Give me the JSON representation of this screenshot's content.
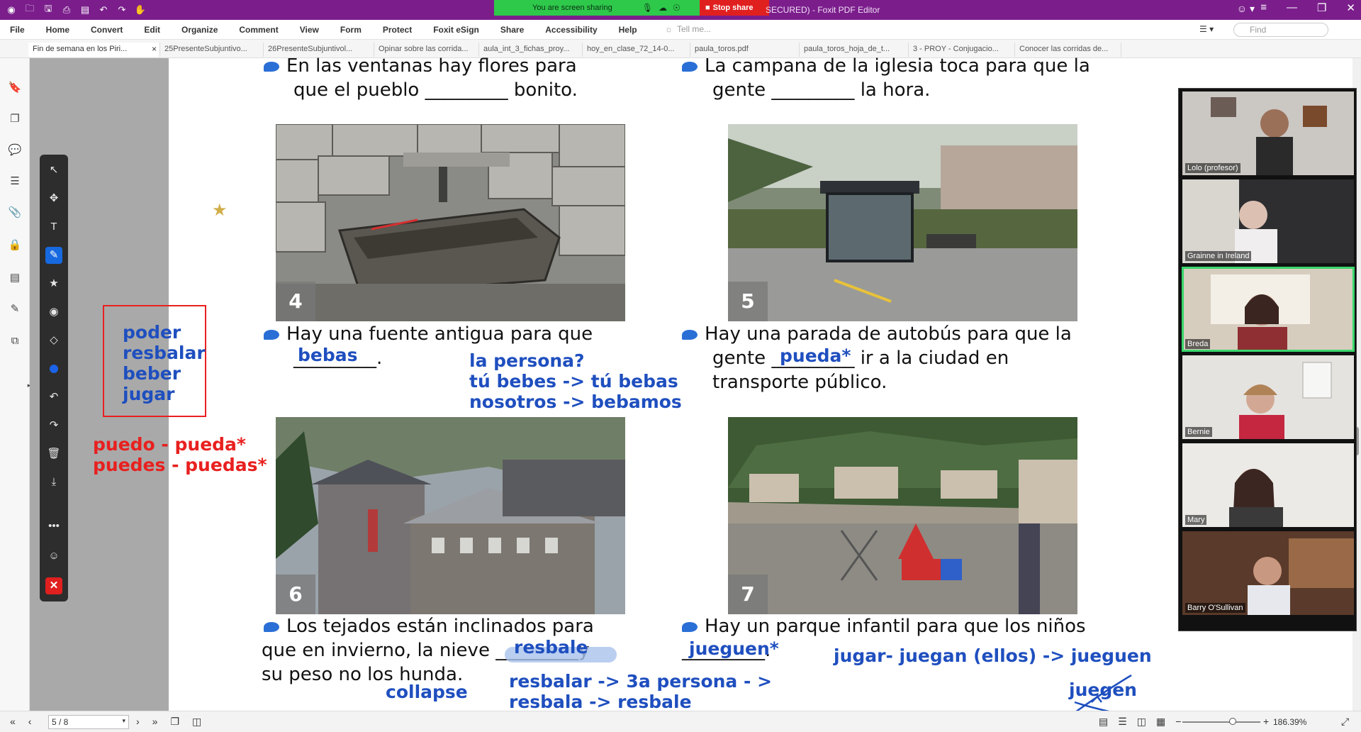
{
  "titlebar": {
    "share_text": "You are screen sharing",
    "stop_label": "Stop share",
    "window_title": "SECURED) - Foxit PDF Editor"
  },
  "menu": {
    "items": [
      "File",
      "Home",
      "Convert",
      "Edit",
      "Organize",
      "Comment",
      "View",
      "Form",
      "Protect",
      "Foxit eSign",
      "Share",
      "Accessibility",
      "Help"
    ],
    "tell_me": "Tell me...",
    "find_placeholder": "Find"
  },
  "tabs": [
    "Fin de semana en los Piri...",
    "25PresenteSubjuntivo...",
    "26PresenteSubjuntivol...",
    "Opinar sobre las corrida...",
    "aula_int_3_fichas_proy...",
    "hoy_en_clase_72_14-0...",
    "paula_toros.pdf",
    "paula_toros_hoja_de_t...",
    "3 - PROY - Conjugacio...",
    "Conocer las corridas de..."
  ],
  "worksheet": {
    "s3_line1": "En las ventanas hay flores para",
    "s3_line2": "que el pueblo _________ bonito.",
    "sX_line1": "La campana de la iglesia toca para que la",
    "sX_line2": "gente _________ la hora.",
    "p4_num": "4",
    "p5_num": "5",
    "p6_num": "6",
    "p7_num": "7",
    "s4_line1": "Hay una fuente antigua para que",
    "s4_blank": "_________.",
    "s5_line1": "Hay una parada de autobús para que la",
    "s5_line2a": "gente",
    "s5_blank": "_________",
    "s5_line2b": "ir a la ciudad en",
    "s5_line3": "transporte público.",
    "s6_line1": "Los tejados están inclinados para",
    "s6_line2a": "que en invierno, la nieve",
    "s6_blank": "_________",
    "s6_line2b": "y",
    "s6_line3": "su peso no los hunda.",
    "s7_line1": "Hay un parque infantil para que los niños",
    "s7_blank": "_________."
  },
  "annotations": {
    "box_words": [
      "poder",
      "resbalar",
      "beber",
      "jugar"
    ],
    "red_line1": "puedo - pueda*",
    "red_line2": "puedes - puedas*",
    "bebas": "bebas",
    "persona_q": "la persona?",
    "bebes": "tú bebes ->  tú bebas",
    "bebemos": "nosotros -> bebamos",
    "pueda": "pueda*",
    "resbale": "resbale",
    "collapse": "collapse",
    "resbalar_rule1": "resbalar -> 3a persona - >",
    "resbalar_rule2": "resbala -> resbale",
    "jueguen": "jueguen*",
    "jugar_rule": "jugar- juegan (ellos) -> jueguen",
    "juegen": "juegen"
  },
  "participants": [
    {
      "name": "Lolo (profesor)"
    },
    {
      "name": "Grainne in Ireland"
    },
    {
      "name": "Breda"
    },
    {
      "name": "Bernie"
    },
    {
      "name": "Mary"
    },
    {
      "name": "Barry O'Sullivan"
    }
  ],
  "status": {
    "page": "5 / 8",
    "zoom": "186.39%"
  },
  "colors": {
    "titlebar": "#7b1e8c",
    "share_green": "#2ec84a",
    "stop_red": "#e0201f",
    "annotation_blue": "#1f4fbf",
    "annotation_red": "#e8201f"
  }
}
